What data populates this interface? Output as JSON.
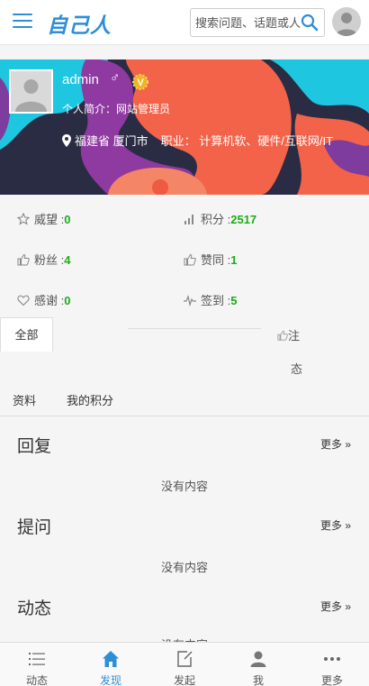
{
  "header": {
    "logo_text": "自己人",
    "search_placeholder": "搜索问题、话题或人"
  },
  "profile": {
    "username": "admin",
    "gender_symbol": "♂",
    "badge": "V",
    "bio": "个人简介：网站管理员",
    "location": "福建省 厦门市",
    "job_label": "职业：",
    "job": "计算机软、硬件/互联网/IT"
  },
  "stats": [
    {
      "label": "威望 :",
      "value": "0",
      "icon": "star-icon"
    },
    {
      "label": "积分 :",
      "value": "2517",
      "icon": "bar-chart-icon"
    },
    {
      "label": "粉丝 :",
      "value": "4",
      "icon": "thumb-up-icon"
    },
    {
      "label": "赞同 :",
      "value": "1",
      "icon": "thumb-up-icon"
    },
    {
      "label": "感谢 :",
      "value": "0",
      "icon": "heart-icon"
    },
    {
      "label": "签到 :",
      "value": "5",
      "icon": "pulse-icon"
    }
  ],
  "tabs": {
    "all": "全部",
    "follow": "注",
    "dynamic": "态",
    "info": "资料",
    "score": "我的积分"
  },
  "sections": [
    {
      "title": "回复",
      "more": "更多 »",
      "empty": "没有内容"
    },
    {
      "title": "提问",
      "more": "更多 »",
      "empty": "没有内容"
    },
    {
      "title": "动态",
      "more": "更多 »",
      "empty": "没有内容"
    }
  ],
  "bottom_nav": [
    {
      "label": "动态",
      "icon": "list-icon",
      "active": false
    },
    {
      "label": "发现",
      "icon": "home-icon",
      "active": true
    },
    {
      "label": "发起",
      "icon": "compose-icon",
      "active": false
    },
    {
      "label": "我",
      "icon": "user-icon",
      "active": false
    },
    {
      "label": "更多",
      "icon": "more-icon",
      "active": false
    }
  ],
  "colors": {
    "accent": "#2d8ed8",
    "value_green": "#1aad19"
  }
}
